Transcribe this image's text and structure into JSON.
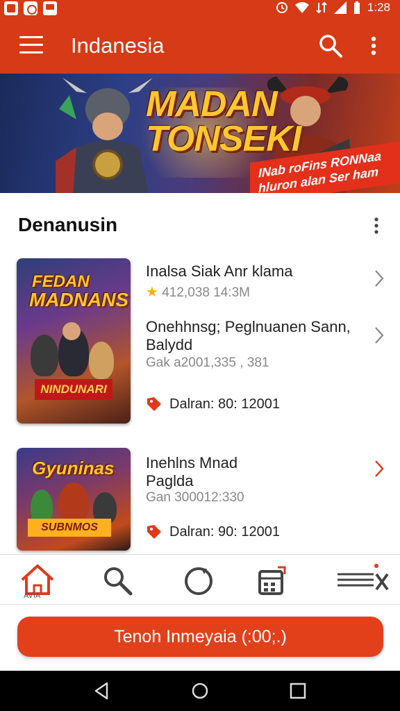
{
  "status_bar": {
    "time": "1:28"
  },
  "app_bar": {
    "title": "Indanesia"
  },
  "banner": {
    "title_line1": "MADAN",
    "title_line2": "TONSEKI",
    "ribbon_line1": "INab roFins RONNaa",
    "ribbon_line2": "hluron alan Ser ham"
  },
  "section": {
    "title": "Denanusin"
  },
  "games": [
    {
      "thumb_logo1": "FEDAN",
      "thumb_logo2": "MADNANS",
      "thumb_badge": "NINDUNARI",
      "title": "Inalsa Siak Anr klama",
      "rating_meta": "412,038 14:3M",
      "subtitle": "Onehhnsg; Peglnuanen Sann, Balydd",
      "meta": "Gak a2001,335 , 381",
      "price": "Dalran: 80: 12001"
    },
    {
      "thumb_logo1": "Gyuninas",
      "thumb_badge": "SUBNMOS",
      "title": "Inehlns Mnad Paglda",
      "meta": "Gan 300012:330",
      "price": "Dalran: 90: 12001"
    }
  ],
  "bottom_nav": {
    "home_label": "AVIA"
  },
  "cta": {
    "label": "Tenoh Inmeyaia (:00;.)"
  },
  "colors": {
    "primary": "#d63a16",
    "accent": "#e2401a"
  }
}
